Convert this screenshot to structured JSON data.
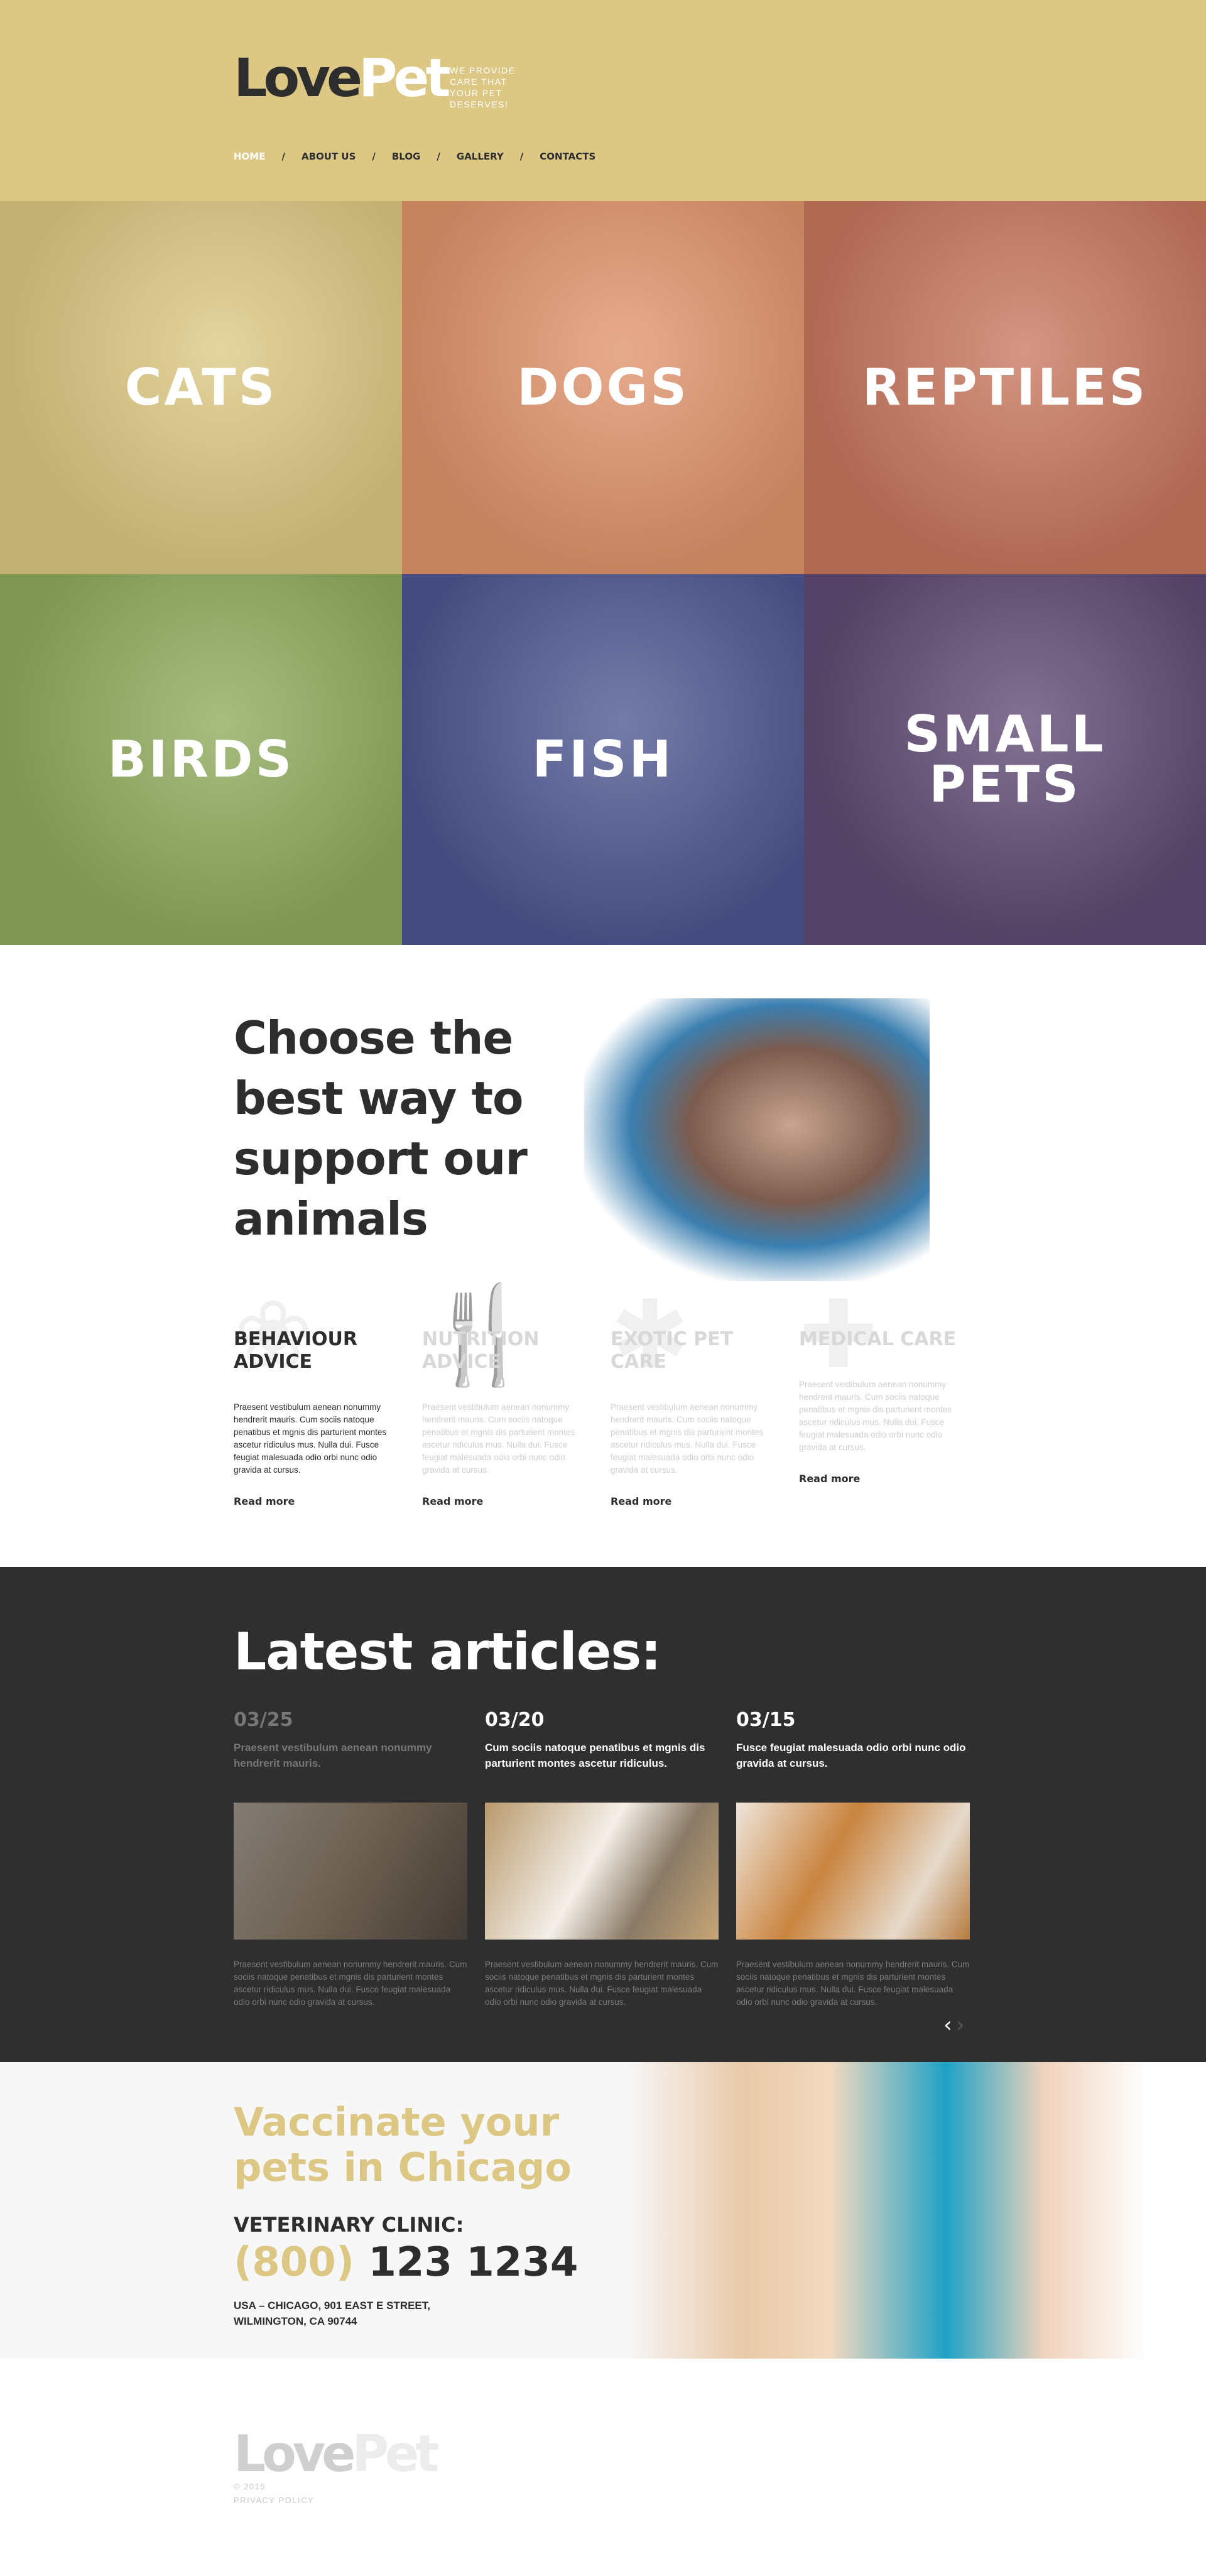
{
  "header": {
    "logo_part1": "Love",
    "logo_part2": "Pet",
    "tagline": "We provide care that your pet deserves!",
    "nav": [
      "HOME",
      "ABOUT US",
      "BLOG",
      "GALLERY",
      "CONTACTS"
    ],
    "nav_separator": "/"
  },
  "categories": [
    {
      "label": "CATS",
      "color": "#dcc882"
    },
    {
      "label": "DOGS",
      "color": "#e0946c"
    },
    {
      "label": "REPTILES",
      "color": "#c8775e"
    },
    {
      "label": "BIRDS",
      "color": "#8fab5c"
    },
    {
      "label": "FISH",
      "color": "#4f5791"
    },
    {
      "label": "SMALL PETS",
      "color": "#5f4a73"
    }
  ],
  "support": {
    "headline": "Choose the best way to support our animals",
    "services": [
      {
        "title": "Behaviour advice",
        "icon": "paw-icon",
        "text": "Praesent vestibulum aenean nonummy hendrerit mauris. Cum sociis natoque penatibus et mgnis dis parturient montes ascetur ridiculus mus. Nulla dui. Fusce feugiat malesuada odio orbi nunc odio gravida at cursus.",
        "link": "Read more"
      },
      {
        "title": "Nutrition advice",
        "icon": "fork-knife-icon",
        "text": "Praesent vestibulum aenean nonummy hendrerit mauris. Cum sociis natoque penatibus et mgnis dis parturient montes ascetur ridiculus mus. Nulla dui. Fusce feugiat malesuada odio orbi nunc odio gravida at cursus.",
        "link": "Read more"
      },
      {
        "title": "Exotic pet care",
        "icon": "bug-icon",
        "text": "Praesent vestibulum aenean nonummy hendrerit mauris. Cum sociis natoque penatibus et mgnis dis parturient montes ascetur ridiculus mus. Nulla dui. Fusce feugiat malesuada odio orbi nunc odio gravida at cursus.",
        "link": "Read more"
      },
      {
        "title": "Medical care",
        "icon": "medical-kit-icon",
        "text": "Praesent vestibulum aenean nonummy hendrerit mauris. Cum sociis natoque penatibus et mgnis dis parturient montes ascetur ridiculus mus. Nulla dui. Fusce feugiat malesuada odio orbi nunc odio gravida at cursus.",
        "link": "Read more"
      }
    ]
  },
  "articles": {
    "heading": "Latest articles:",
    "items": [
      {
        "date": "03/25",
        "title": "Praesent vestibulum aenean nonummy hendrerit mauris.",
        "text": "Praesent vestibulum aenean nonummy hendrerit mauris. Cum sociis natoque penatibus et mgnis dis parturient montes ascetur ridiculus mus. Nulla dui. Fusce feugiat malesuada odio orbi nunc odio gravida at cursus."
      },
      {
        "date": "03/20",
        "title": "Cum sociis natoque penatibus et mgnis dis parturient montes ascetur ridiculus.",
        "text": "Praesent vestibulum aenean nonummy hendrerit mauris. Cum sociis natoque penatibus et mgnis dis parturient montes ascetur ridiculus mus. Nulla dui. Fusce feugiat malesuada odio orbi nunc odio gravida at cursus."
      },
      {
        "date": "03/15",
        "title": "Fusce feugiat malesuada odio orbi nunc odio gravida at cursus.",
        "text": "Praesent vestibulum aenean nonummy hendrerit mauris. Cum sociis natoque penatibus et mgnis dis parturient montes ascetur ridiculus mus. Nulla dui. Fusce feugiat malesuada odio orbi nunc odio gravida at cursus."
      }
    ],
    "prev": "‹",
    "next": "›"
  },
  "clinic": {
    "headline": "Vaccinate your pets in Chicago",
    "label": "VETERINARY CLINIC:",
    "phone_code": "(800)",
    "phone_number": "123 1234",
    "address": "USA – Chicago, 901 East E Street, Wilmington, CA 90744"
  },
  "footer": {
    "logo_part1": "Love",
    "logo_part2": "Pet",
    "copyright": "© 2015",
    "privacy": "PRIVACY POLICY"
  }
}
